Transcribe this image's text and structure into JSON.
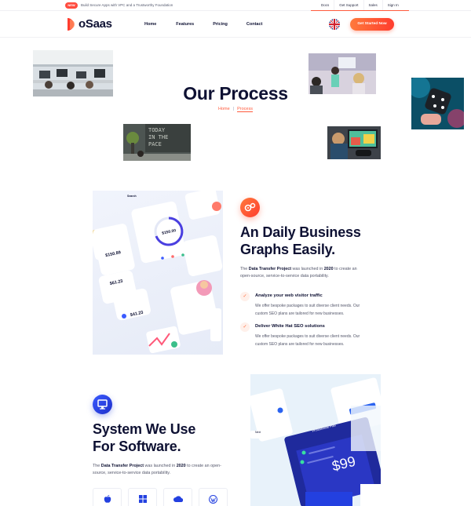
{
  "topbar": {
    "badge": "NEW",
    "message": "Build Secure Apps with VPC and a Trustworthy Foundation",
    "links": [
      "Docs",
      "Get Support",
      "Sales",
      "Sign In"
    ]
  },
  "header": {
    "logo": "oSaas",
    "nav": [
      "Home",
      "Features",
      "Pricing",
      "Contact"
    ],
    "cta": "Get Started Now"
  },
  "hero": {
    "title": "Our Process",
    "breadcrumb": {
      "home": "Home",
      "separator": "|",
      "current": "Process"
    }
  },
  "section1": {
    "title_line1": "An Daily Business",
    "title_line2": "Graphs Easily.",
    "para_pre": "The ",
    "para_bold1": "Data Transfer Project",
    "para_mid": " was launched in ",
    "para_bold2": "2020",
    "para_post": " to create an open-source, service-to-service data portability.",
    "features": [
      {
        "title": "Analyze your web visitor traffic",
        "desc": "We offer bespoke packages to suit diverse client needs. Our custom SEO plans are tailored for new businesses."
      },
      {
        "title": "Deliver White Hat SEO solutions",
        "desc": "We offer bespoke packages to suit diverse client needs. Our custom SEO plans are tailored for new businesses."
      }
    ],
    "illustration": {
      "card_amount_1": "$150.89",
      "card_amount_2": "$61.23",
      "card_amount_3": "$41.23",
      "ring_amount": "$150.00",
      "label_search": "Search"
    }
  },
  "section2": {
    "title_line1": "System We Use",
    "title_line2": "For Software.",
    "para_pre": "The ",
    "para_bold1": "Data Transfer Project",
    "para_mid": " was launched in ",
    "para_bold2": "2020",
    "para_post": " to create an open-source, service-to-service data portability.",
    "illustration": {
      "plan_name": "Professional Plan",
      "price": "$99",
      "button": "Next"
    },
    "os_icons": [
      "apple-icon",
      "windows-icon",
      "cloud-icon",
      "wordpress-icon"
    ]
  },
  "colors": {
    "accent": "#ff5a3c",
    "navy": "#0e1133",
    "blue": "#2340e0"
  }
}
